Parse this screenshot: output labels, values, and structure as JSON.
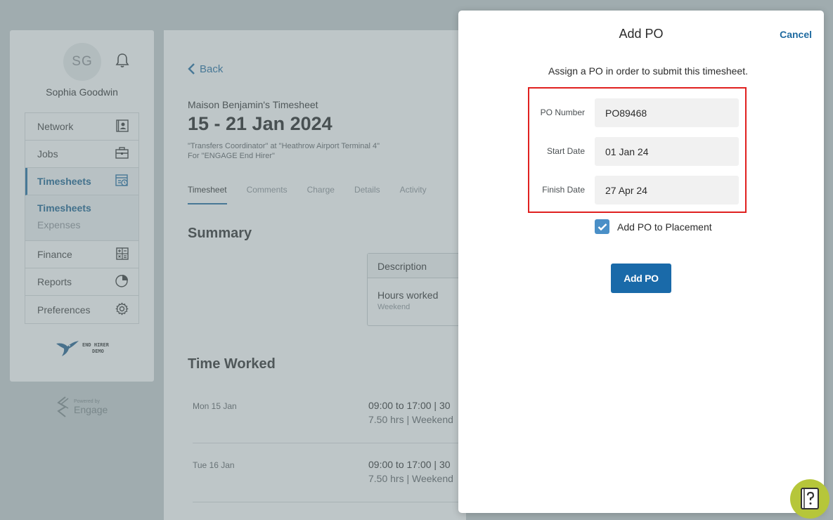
{
  "user": {
    "initials": "SG",
    "name": "Sophia Goodwin"
  },
  "nav": {
    "items": [
      {
        "label": "Network"
      },
      {
        "label": "Jobs"
      },
      {
        "label": "Timesheets"
      },
      {
        "label": "Finance"
      },
      {
        "label": "Reports"
      },
      {
        "label": "Preferences"
      }
    ],
    "sub": [
      {
        "label": "Timesheets"
      },
      {
        "label": "Expenses"
      }
    ]
  },
  "branding": {
    "demo_line1": "END HIRER",
    "demo_line2": "DEMO",
    "powered_by": "Powered by",
    "engage": "Engage"
  },
  "timesheet": {
    "back": "Back",
    "owner": "Maison Benjamin's Timesheet",
    "range": "15 - 21 Jan 2024",
    "meta1": "\"Transfers Coordinator\" at \"Heathrow Airport Terminal 4\"",
    "meta2": "For \"ENGAGE End Hirer\"",
    "tabs": [
      "Timesheet",
      "Comments",
      "Charge",
      "Details",
      "Activity"
    ],
    "summary_title": "Summary",
    "summary_header": "Description",
    "summary_item": "Hours worked",
    "summary_sub": "Weekend",
    "time_worked_title": "Time Worked",
    "rows": [
      {
        "day": "Mon 15 Jan",
        "time": "09:00 to 17:00  |  30",
        "hrs": "7.50 hrs  |  Weekend"
      },
      {
        "day": "Tue 16 Jan",
        "time": "09:00 to 17:00  |  30",
        "hrs": "7.50 hrs  |  Weekend"
      }
    ]
  },
  "modal": {
    "title": "Add PO",
    "cancel": "Cancel",
    "instruction": "Assign a PO in order to submit this timesheet.",
    "fields": [
      {
        "label": "PO Number",
        "value": "PO89468"
      },
      {
        "label": "Start Date",
        "value": "01 Jan 24"
      },
      {
        "label": "Finish Date",
        "value": "27 Apr 24"
      }
    ],
    "checkbox_label": "Add PO to Placement",
    "checkbox_checked": true,
    "submit": "Add PO"
  },
  "colors": {
    "brand": "#1a6aa9",
    "highlight": "#e0201f",
    "help": "#b6c63a"
  }
}
